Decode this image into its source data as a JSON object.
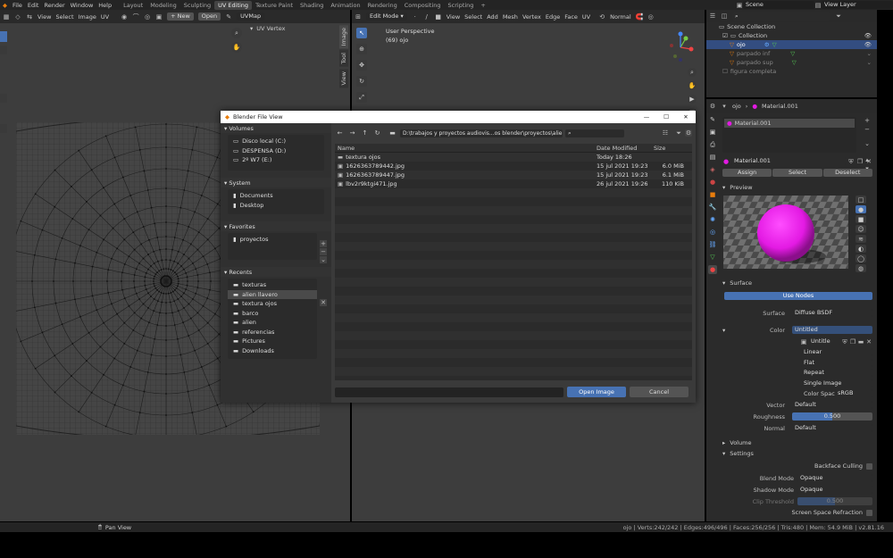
{
  "menu": {
    "items": [
      "File",
      "Edit",
      "Render",
      "Window",
      "Help"
    ]
  },
  "workspaces": {
    "tabs": [
      "Layout",
      "Modeling",
      "Sculpting",
      "UV Editing",
      "Texture Paint",
      "Shading",
      "Animation",
      "Rendering",
      "Compositing",
      "Scripting"
    ],
    "active": "UV Editing",
    "add": "+"
  },
  "topright": {
    "scene": "Scene",
    "view_layer": "View Layer"
  },
  "uv_editor": {
    "menu": [
      "View",
      "Select",
      "Image",
      "UV"
    ],
    "new_label": "New",
    "open_label": "Open",
    "uvmap": "UVMap",
    "panel_label": "UV Vertex",
    "side_tabs": [
      "Image",
      "Tool",
      "View"
    ]
  },
  "viewport": {
    "mode": "Edit Mode",
    "menu": [
      "View",
      "Select",
      "Add",
      "Mesh",
      "Vertex",
      "Edge",
      "Face",
      "UV"
    ],
    "orientation": "Normal",
    "perspective": "User Perspective",
    "object": "(69) ojo"
  },
  "outliner": {
    "root": "Scene Collection",
    "collection": "Collection",
    "items": [
      "ojo",
      "parpado inf",
      "parpado sup",
      "figura completa"
    ]
  },
  "properties": {
    "object": "ojo",
    "material_header": "Material.001",
    "slot": "Material.001",
    "material": "Material.001",
    "assign": "Assign",
    "select": "Select",
    "deselect": "Deselect",
    "preview": "Preview",
    "surface_section": "Surface",
    "use_nodes": "Use Nodes",
    "surface_label": "Surface",
    "surface_value": "Diffuse BSDF",
    "color_label": "Color",
    "color_value": "Untitled",
    "image_name": "Untitle",
    "interp": "Linear",
    "proj": "Flat",
    "ext": "Repeat",
    "source": "Single Image",
    "colorspace_label": "Color Space",
    "colorspace_value": "sRGB",
    "vector_label": "Vector",
    "vector_value": "Default",
    "roughness_label": "Roughness",
    "roughness_value": "0.500",
    "normal_label": "Normal",
    "normal_value": "Default",
    "volume": "Volume",
    "settings": "Settings",
    "backface": "Backface Culling",
    "blend_label": "Blend Mode",
    "blend_value": "Opaque",
    "shadow_label": "Shadow Mode",
    "shadow_value": "Opaque",
    "clip_label": "Clip Threshold",
    "clip_value": "0.500",
    "ssr": "Screen Space Refraction"
  },
  "dialog": {
    "title": "Blender File View",
    "path": "D:\\trabajos y proyectos audiovis...os blender\\proyectos\\alien llavero\\",
    "volumes_label": "Volumes",
    "volumes": [
      "Disco local (C:)",
      "DESPENSA (D:)",
      "2º W7 (E:)"
    ],
    "system_label": "System",
    "system": [
      "Documents",
      "Desktop"
    ],
    "favorites_label": "Favorites",
    "favorites": [
      "proyectos"
    ],
    "recents_label": "Recents",
    "recents": [
      "texturas",
      "alien llavero",
      "textura ojos",
      "barco",
      "alien",
      "referencias",
      "Pictures",
      "Downloads"
    ],
    "recents_selected": "alien llavero",
    "columns": {
      "name": "Name",
      "date": "Date Modified",
      "size": "Size"
    },
    "files": [
      {
        "name": "textura ojos",
        "date": "Today 18:26",
        "size": "",
        "icon": "folder-icon"
      },
      {
        "name": "1626363789442.jpg",
        "date": "15 jul 2021 19:23",
        "size": "6.0 MiB",
        "icon": "image-icon"
      },
      {
        "name": "1626363789447.jpg",
        "date": "15 jul 2021 19:23",
        "size": "6.1 MiB",
        "icon": "image-icon"
      },
      {
        "name": "lbv2r9ktgi471.jpg",
        "date": "26 jul 2021 19:26",
        "size": "110 KiB",
        "icon": "image-icon"
      }
    ],
    "open_label": "Open Image",
    "cancel_label": "Cancel"
  },
  "statusbar": {
    "left": "Pan View",
    "right": "ojo | Verts:242/242 | Edges:496/496 | Faces:256/256 | Tris:480 | Mem: 54.9 MiB | v2.81.16"
  },
  "colors": {
    "accent": "#4772b3",
    "magenta": "#e31ae3",
    "bg": "#2b2b2b"
  }
}
